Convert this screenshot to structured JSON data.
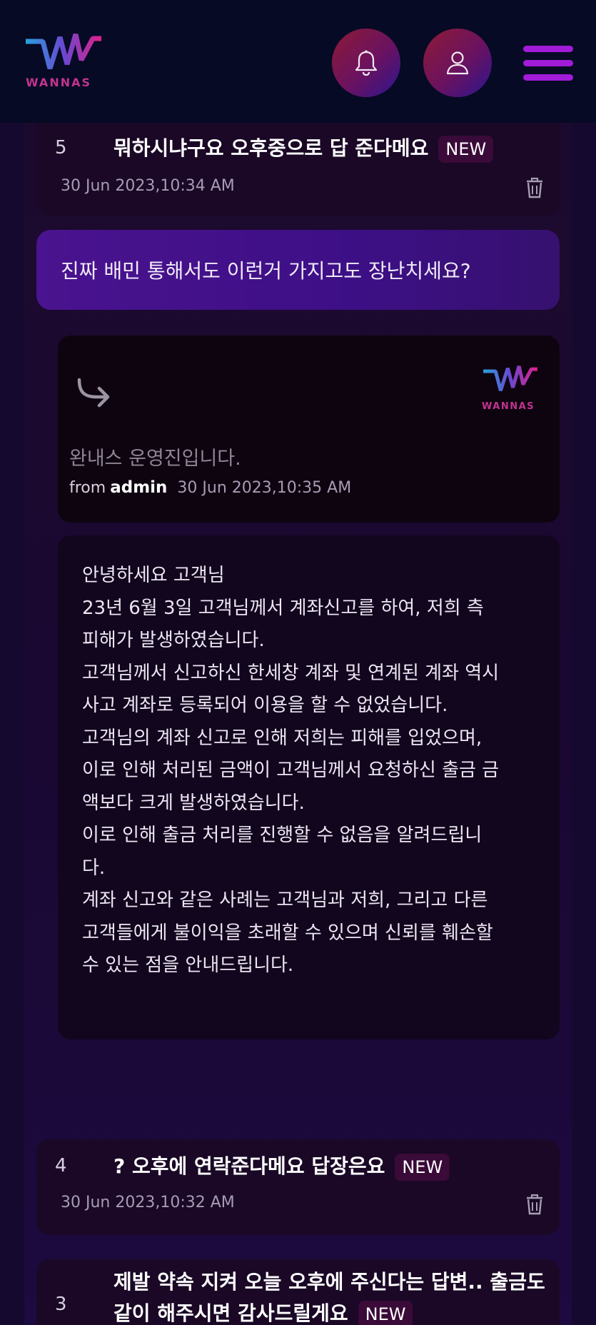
{
  "header": {
    "logo_text": "WANNAS",
    "bell_icon": "bell-icon",
    "user_icon": "user-icon",
    "menu_icon": "hamburger-menu-icon"
  },
  "colors": {
    "header_bg": "#060a24",
    "accent_purple": "#a11bd8",
    "question_bg": "#4a138f",
    "badge_bg": "#3a0a38"
  },
  "posts": [
    {
      "number": "5",
      "title": "뭐하시냐구요 오후중으로 답 준다메요",
      "badge": "NEW",
      "date": "30 Jun 2023,10:34 AM"
    },
    {
      "number": "4",
      "title": "? 오후에 연락준다메요 답장은요",
      "badge": "NEW",
      "date": "30 Jun 2023,10:32 AM"
    },
    {
      "number": "3",
      "title_line1": "제발 약속 지켜 오늘 오후에 주신다는 답변.. 출금도",
      "title_line2": "같이 해주시면 감사드릴게요",
      "badge": "NEW"
    }
  ],
  "question": "진짜 배민 통해서도 이런거 가지고도 장난치세요?",
  "reply": {
    "logo_text": "WANNAS",
    "intro": "완내스 운영진입니다.",
    "from_label": "from",
    "author": "admin",
    "date": "30 Jun 2023,10:35 AM",
    "body_lines": [
      "안녕하세요 고객님",
      "23년 6월 3일 고객님께서 계좌신고를 하여, 저희 측",
      "피해가 발생하였습니다.",
      "고객님께서 신고하신 한세창 계좌 및 연계된 계좌 역시",
      "사고 계좌로 등록되어 이용을 할 수 없었습니다.",
      "고객님의 계좌 신고로 인해 저희는 피해를 입었으며,",
      "이로 인해 처리된 금액이 고객님께서 요청하신 출금 금",
      "액보다 크게 발생하였습니다.",
      "이로 인해 출금 처리를 진행할 수 없음을 알려드립니",
      "다.",
      "계좌 신고와 같은 사례는 고객님과 저희, 그리고 다른",
      "고객들에게 불이익을 초래할 수 있으며 신뢰를 훼손할",
      "수 있는 점을 안내드립니다."
    ]
  }
}
